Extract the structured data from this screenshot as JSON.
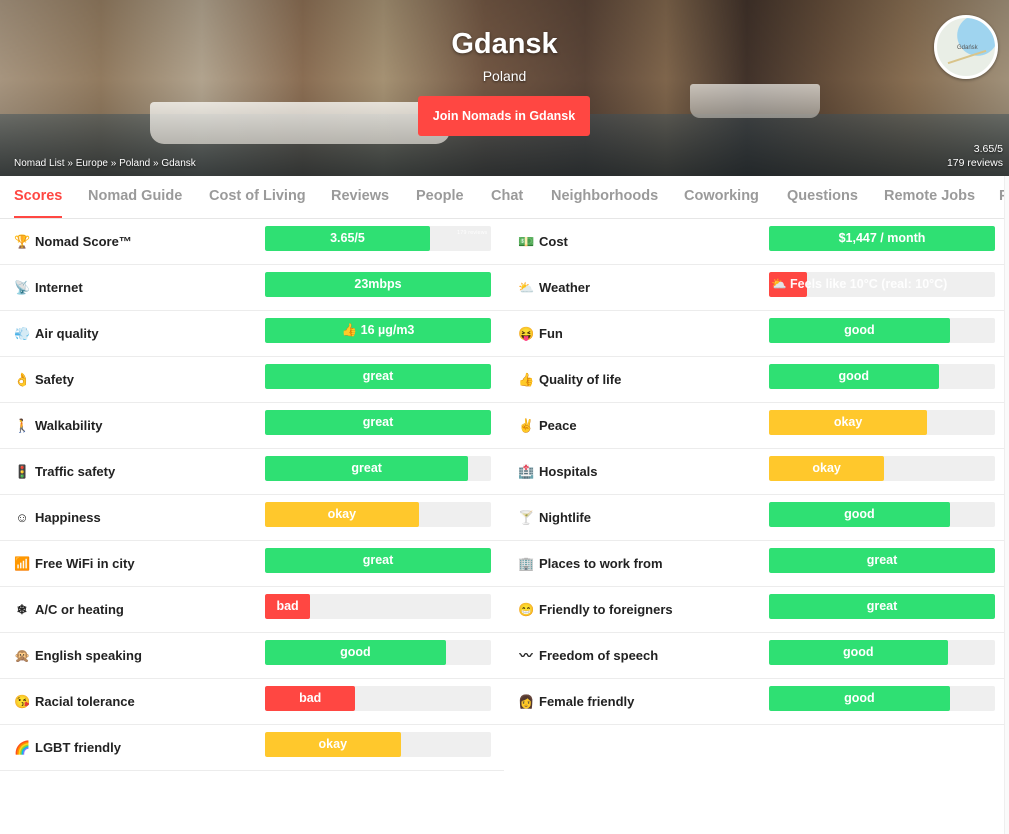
{
  "hero": {
    "city": "Gdansk",
    "country": "Poland",
    "join_label": "Join Nomads in Gdansk",
    "breadcrumb": [
      "Nomad List",
      "Europe",
      "Poland",
      "Gdansk"
    ],
    "rating": "3.65/5",
    "reviews": "179 reviews",
    "map_label": "Gdańsk"
  },
  "tabs": [
    "Scores",
    "Nomad Guide",
    "Cost of Living",
    "Reviews",
    "People",
    "Chat",
    "Neighborhoods",
    "Coworking",
    "Questions",
    "Remote Jobs",
    "P"
  ],
  "active_tab": "Scores",
  "scores": {
    "left": [
      {
        "icon": "trophy-icon",
        "glyph": "🏆",
        "label": "Nomad Score™",
        "value": "3.65/5",
        "level": 0.73,
        "color": "#2fe073",
        "extra": "179 reviews"
      },
      {
        "icon": "satellite-icon",
        "glyph": "📡",
        "label": "Internet",
        "value": "23mbps",
        "level": 1.0,
        "color": "#2fe073"
      },
      {
        "icon": "wind-icon",
        "glyph": "💨",
        "label": "Air quality",
        "value": "👍 16 µg/m3",
        "level": 1.0,
        "color": "#2fe073"
      },
      {
        "icon": "ok-hand-icon",
        "glyph": "👌",
        "label": "Safety",
        "value": "great",
        "level": 1.0,
        "color": "#2fe073"
      },
      {
        "icon": "walking-icon",
        "glyph": "🚶",
        "label": "Walkability",
        "value": "great",
        "level": 1.0,
        "color": "#2fe073"
      },
      {
        "icon": "traffic-light-icon",
        "glyph": "🚦",
        "label": "Traffic safety",
        "value": "great",
        "level": 0.9,
        "color": "#2fe073"
      },
      {
        "icon": "smile-icon",
        "glyph": "☺",
        "label": "Happiness",
        "value": "okay",
        "level": 0.68,
        "color": "#ffc82c"
      },
      {
        "icon": "wifi-icon",
        "glyph": "📶",
        "label": "Free WiFi in city",
        "value": "great",
        "level": 1.0,
        "color": "#2fe073"
      },
      {
        "icon": "snowflake-icon",
        "glyph": "❄",
        "label": "A/C or heating",
        "value": "bad",
        "level": 0.2,
        "color": "#ff4742"
      },
      {
        "icon": "speak-monkey-icon",
        "glyph": "🙊",
        "label": "English speaking",
        "value": "good",
        "level": 0.8,
        "color": "#2fe073"
      },
      {
        "icon": "face-icon",
        "glyph": "😘",
        "label": "Racial tolerance",
        "value": "bad",
        "level": 0.4,
        "color": "#ff4742"
      },
      {
        "icon": "rainbow-icon",
        "glyph": "🌈",
        "label": "LGBT friendly",
        "value": "okay",
        "level": 0.6,
        "color": "#ffc82c"
      }
    ],
    "right": [
      {
        "icon": "money-icon",
        "glyph": "💵",
        "label": "Cost",
        "value": "$1,447 / month",
        "level": 1.0,
        "color": "#2fe073"
      },
      {
        "icon": "cloud-icon",
        "glyph": "⛅",
        "label": "Weather",
        "value": "⛅ Feels like 10°C (real: 10°C)",
        "level": 0.17,
        "color": "#ff4742"
      },
      {
        "icon": "party-face-icon",
        "glyph": "😝",
        "label": "Fun",
        "value": "good",
        "level": 0.8,
        "color": "#2fe073"
      },
      {
        "icon": "thumbs-up-icon",
        "glyph": "👍",
        "label": "Quality of life",
        "value": "good",
        "level": 0.75,
        "color": "#2fe073"
      },
      {
        "icon": "peace-icon",
        "glyph": "✌",
        "label": "Peace",
        "value": "okay",
        "level": 0.7,
        "color": "#ffc82c"
      },
      {
        "icon": "hospital-icon",
        "glyph": "🏥",
        "label": "Hospitals",
        "value": "okay",
        "level": 0.51,
        "color": "#ffc82c"
      },
      {
        "icon": "cocktail-icon",
        "glyph": "🍸",
        "label": "Nightlife",
        "value": "good",
        "level": 0.8,
        "color": "#2fe073"
      },
      {
        "icon": "office-icon",
        "glyph": "🏢",
        "label": "Places to work from",
        "value": "great",
        "level": 1.0,
        "color": "#2fe073"
      },
      {
        "icon": "smile-big-icon",
        "glyph": "😁",
        "label": "Friendly to foreigners",
        "value": "great",
        "level": 1.0,
        "color": "#2fe073"
      },
      {
        "icon": "mustache-icon",
        "glyph": "〰",
        "label": "Freedom of speech",
        "value": "good",
        "level": 0.79,
        "color": "#2fe073"
      },
      {
        "icon": "woman-icon",
        "glyph": "👩",
        "label": "Female friendly",
        "value": "good",
        "level": 0.8,
        "color": "#2fe073"
      }
    ]
  }
}
